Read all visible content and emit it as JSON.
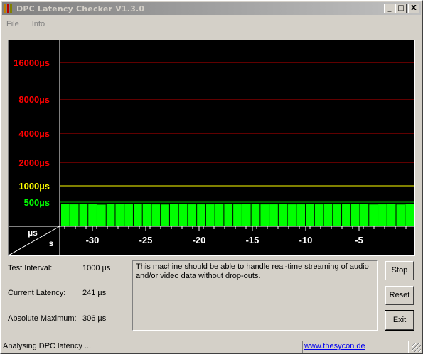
{
  "window": {
    "title": "DPC Latency Checker V1.3.0",
    "buttons": {
      "minimize": "_",
      "maximize": "□",
      "close": "X"
    }
  },
  "menu": [
    "File",
    "Info"
  ],
  "graph": {
    "background_color": "#000000",
    "y_ticks": [
      {
        "label": "16000µs",
        "color": "#ff0000"
      },
      {
        "label": "8000µs",
        "color": "#ff0000"
      },
      {
        "label": "4000µs",
        "color": "#ff0000"
      },
      {
        "label": "2000µs",
        "color": "#ff0000"
      },
      {
        "label": "1000µs",
        "color": "#ffff00"
      },
      {
        "label": "500µs",
        "color": "#00ff00"
      }
    ],
    "x_ticks": [
      "-30",
      "-25",
      "-20",
      "-15",
      "-10",
      "-5"
    ],
    "corner_labels": {
      "y_unit": "µs",
      "x_unit": "s"
    },
    "bar_color": "#00ff00",
    "bar_values_us": [
      306,
      286,
      289,
      296,
      267,
      289,
      306,
      289,
      289,
      296,
      284,
      276,
      306,
      296,
      286,
      286,
      286,
      296,
      296,
      286,
      306,
      306,
      284,
      286,
      296,
      284,
      286,
      296,
      286,
      306,
      286,
      296,
      296,
      296,
      276,
      286,
      316,
      276,
      326
    ]
  },
  "info": {
    "test_interval_label": "Test Interval:",
    "test_interval_value": "1000 µs",
    "current_latency_label": "Current Latency:",
    "current_latency_value": "241 µs",
    "absolute_maximum_label": "Absolute Maximum:",
    "absolute_maximum_value": "306 µs"
  },
  "message": "This machine should be able to handle real-time streaming of audio and/or video data without drop-outs.",
  "buttons": {
    "stop": "Stop",
    "reset": "Reset",
    "exit": "Exit"
  },
  "status": {
    "left": "Analysing DPC latency ...",
    "link": "www.thesycon.de"
  }
}
